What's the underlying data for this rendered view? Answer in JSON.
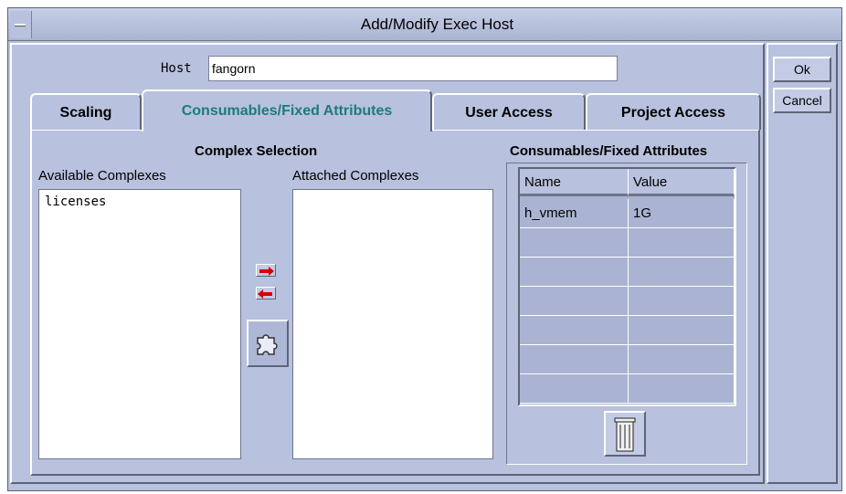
{
  "window": {
    "title": "Add/Modify Exec Host"
  },
  "host": {
    "label": "Host",
    "value": "fangorn"
  },
  "side_buttons": {
    "ok": "Ok",
    "cancel": "Cancel"
  },
  "tabs": [
    {
      "label": "Scaling",
      "selected": false
    },
    {
      "label": "Consumables/Fixed Attributes",
      "selected": true
    },
    {
      "label": "User Access",
      "selected": false
    },
    {
      "label": "Project Access",
      "selected": false
    }
  ],
  "complex_selection": {
    "title": "Complex Selection",
    "available_label": "Available Complexes",
    "attached_label": "Attached Complexes",
    "available_items": [
      "licenses"
    ],
    "attached_items": []
  },
  "consumables": {
    "title": "Consumables/Fixed Attributes",
    "columns": [
      "Name",
      "Value"
    ],
    "rows": [
      [
        "h_vmem",
        "1G"
      ],
      [
        "",
        ""
      ],
      [
        "",
        ""
      ],
      [
        "",
        ""
      ],
      [
        "",
        ""
      ],
      [
        "",
        ""
      ],
      [
        "",
        ""
      ]
    ]
  },
  "icons": {
    "add": "arrow-right-icon",
    "remove": "arrow-left-icon",
    "complex": "puzzle-icon",
    "delete": "trash-icon"
  },
  "colors": {
    "background": "#b8c1dd",
    "selected_tab_text": "#1b7c7c",
    "arrow": "#d40000"
  }
}
